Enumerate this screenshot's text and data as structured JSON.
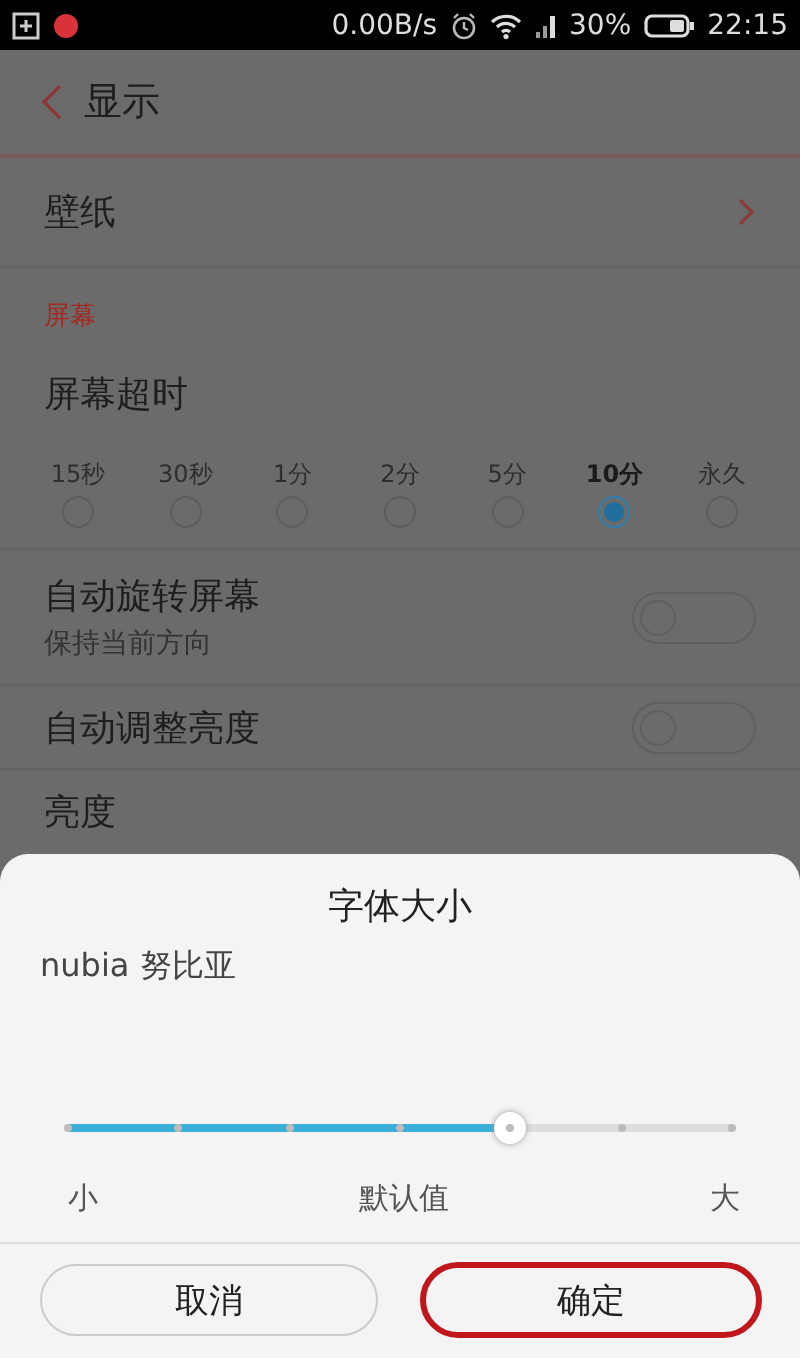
{
  "status_bar": {
    "net_speed": "0.00B/s",
    "battery": "30%",
    "time": "22:15"
  },
  "header": {
    "title": "显示"
  },
  "settings": [
    {
      "kind": "link",
      "label": "壁纸"
    },
    {
      "kind": "section",
      "label": "屏幕"
    },
    {
      "kind": "radio-group",
      "label": "屏幕超时",
      "options": [
        {
          "label": "15秒",
          "selected": false
        },
        {
          "label": "30秒",
          "selected": false
        },
        {
          "label": "1分",
          "selected": false
        },
        {
          "label": "2分",
          "selected": false
        },
        {
          "label": "5分",
          "selected": false
        },
        {
          "label": "10分",
          "selected": true
        },
        {
          "label": "永久",
          "selected": false
        }
      ]
    },
    {
      "kind": "toggle",
      "label": "自动旋转屏幕",
      "subtitle": "保持当前方向",
      "on": false
    },
    {
      "kind": "toggle",
      "label": "自动调整亮度",
      "on": false
    },
    {
      "kind": "plain",
      "label": "亮度"
    }
  ],
  "dialog": {
    "title": "字体大小",
    "font_name": "nubia 努比亚",
    "slider": {
      "level": 0.667,
      "min_label": "小",
      "default_label": "默认值",
      "max_label": "大"
    },
    "buttons": [
      {
        "label": "取消",
        "highlighted": false
      },
      {
        "label": "确定",
        "highlighted": true
      }
    ]
  }
}
